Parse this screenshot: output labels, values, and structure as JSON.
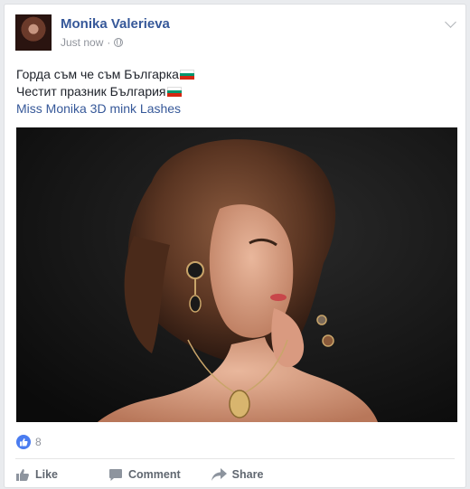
{
  "post": {
    "author": "Monika Valerieva",
    "timestamp": "Just now",
    "separator": "·",
    "privacy_icon": "globe-icon",
    "menu_icon": "chevron-down-icon",
    "text_lines": [
      "Горда съм че съм Българка",
      "Честит празник България"
    ],
    "link_text": "Miss Monika 3D mink Lashes",
    "flag_colors": [
      "#ffffff",
      "#00966e",
      "#d62612"
    ],
    "image_alt_icon": "portrait-photo"
  },
  "reactions": {
    "icon": "like-badge-icon",
    "count": "8"
  },
  "actions": {
    "like": "Like",
    "comment": "Comment",
    "share": "Share"
  },
  "colors": {
    "link": "#365899",
    "meta": "#90949c",
    "action": "#606770",
    "like_badge": "#4a7cf0"
  }
}
